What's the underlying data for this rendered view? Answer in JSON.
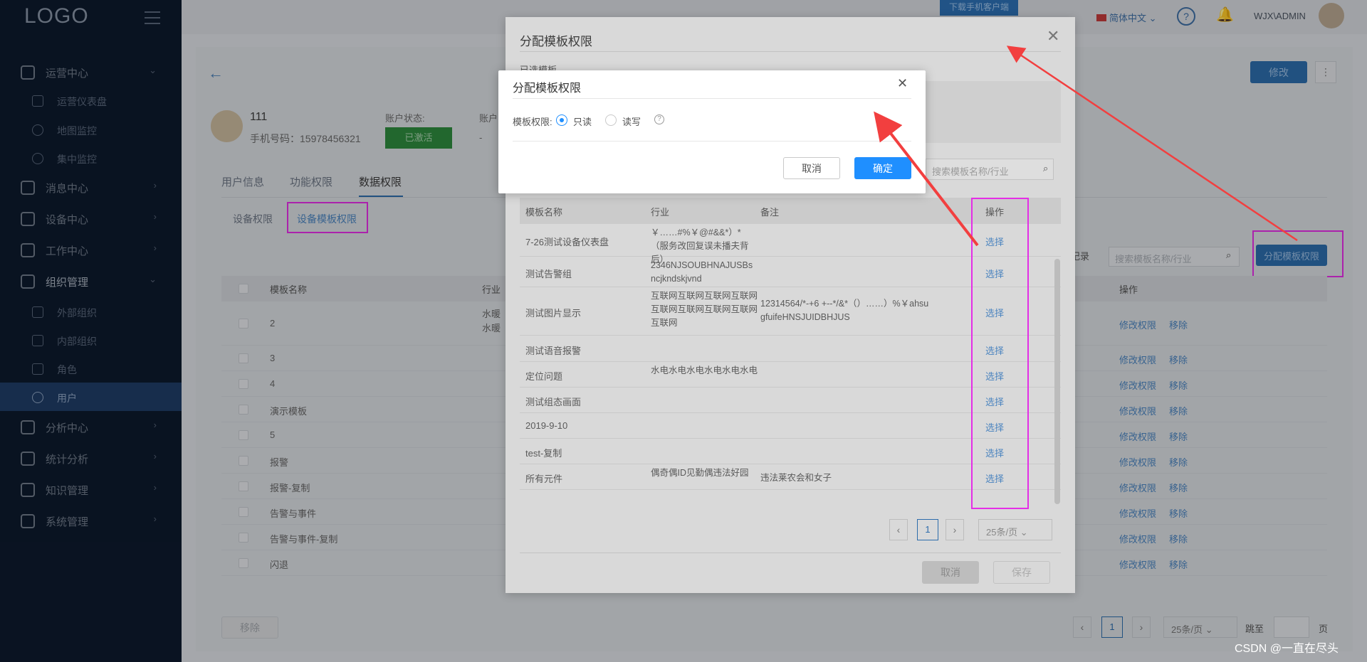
{
  "sidebar": {
    "logo": "LOGO",
    "menu": [
      {
        "label": "运营中心",
        "icon": "home-icon"
      },
      {
        "label": "消息中心",
        "icon": "bell-icon"
      },
      {
        "label": "设备中心",
        "icon": "grid-icon"
      },
      {
        "label": "工作中心",
        "icon": "wrench-icon"
      },
      {
        "label": "组织管理",
        "icon": "org-icon"
      },
      {
        "label": "分析中心",
        "icon": "bar-chart-icon"
      },
      {
        "label": "统计分析",
        "icon": "stats-icon"
      },
      {
        "label": "知识管理",
        "icon": "book-icon"
      },
      {
        "label": "系统管理",
        "icon": "settings-icon"
      }
    ],
    "submenu": [
      {
        "label": "运营仪表盘"
      },
      {
        "label": "地图监控"
      },
      {
        "label": "集中监控"
      },
      {
        "label": "外部组织"
      },
      {
        "label": "内部组织"
      },
      {
        "label": "角色"
      },
      {
        "label": "用户"
      }
    ]
  },
  "topbar": {
    "download": "下载手机客户端",
    "lang": "简体中文",
    "user": "WJX\\ADMIN"
  },
  "user": {
    "name": "111",
    "phone": "手机号码：15978456321",
    "status_label": "账户状态:",
    "status": "已激活",
    "other_label": "账户",
    "other_value": "-"
  },
  "page": {
    "edit": "修改",
    "tabs": [
      "用户信息",
      "功能权限",
      "数据权限"
    ],
    "subtabs": [
      "设备权限",
      "设备模板权限"
    ],
    "table_headers": [
      "模板名称",
      "行业",
      "操作"
    ],
    "rows": [
      "2",
      "3",
      "4",
      "演示模板",
      "5",
      "报警",
      "报警-复制",
      "告警与事件",
      "告警与事件-复制",
      "闪退"
    ],
    "row2_industry": "水暖水暖",
    "edit_perm": "修改权限",
    "remove": "移除",
    "assign_btn": "分配模板权限",
    "search_placeholder": "搜索模板名称/行业",
    "records_label": "条记录",
    "delete_btn": "移除",
    "page_num": "1",
    "page_size": "25条/页",
    "jump": "跳至",
    "page_unit": "页"
  },
  "modal1": {
    "title": "分配模板权限",
    "selected_label": "已选模板",
    "search_placeholder": "搜索模板名称/行业",
    "headers": [
      "模板名称",
      "行业",
      "备注",
      "操作"
    ],
    "rows": [
      {
        "name": "7-26测试设备仪表盘",
        "industry": "￥……#%￥@#&&*）*（服务改回复误未播夫背后）",
        "note": "",
        "op": "选择"
      },
      {
        "name": "测试告警组",
        "industry": "2346NJSOUBHNAJUSBsncjkndskjvnd",
        "note": "",
        "op": "选择"
      },
      {
        "name": "测试图片显示",
        "industry": "互联网互联网互联网互联网互联网互联网互联网互联网互联网",
        "note": "12314564/*-+6 +--*/&*（）……）%￥ahsugfuifeHNSJUIDBHJUS",
        "op": "选择"
      },
      {
        "name": "测试语音报警",
        "industry": "",
        "note": "",
        "op": "选择"
      },
      {
        "name": "定位问题",
        "industry": "水电水电水电水电水电水电",
        "note": "",
        "op": "选择"
      },
      {
        "name": "测试组态画面",
        "industry": "",
        "note": "",
        "op": "选择"
      },
      {
        "name": "2019-9-10",
        "industry": "",
        "note": "",
        "op": "选择"
      },
      {
        "name": "test-复制",
        "industry": "",
        "note": "",
        "op": "选择"
      },
      {
        "name": "所有元件",
        "industry": "偶奇偶ID见勤偶违法好园",
        "note": "违法莱农会和女子",
        "op": "选择"
      }
    ],
    "page_num": "1",
    "page_size": "25条/页",
    "cancel": "取消",
    "save": "保存"
  },
  "modal2": {
    "title": "分配模板权限",
    "perm_label": "模板权限:",
    "opt_read": "只读",
    "opt_write": "读写",
    "cancel": "取消",
    "confirm": "确定"
  },
  "watermark": "CSDN @一直在尽头"
}
